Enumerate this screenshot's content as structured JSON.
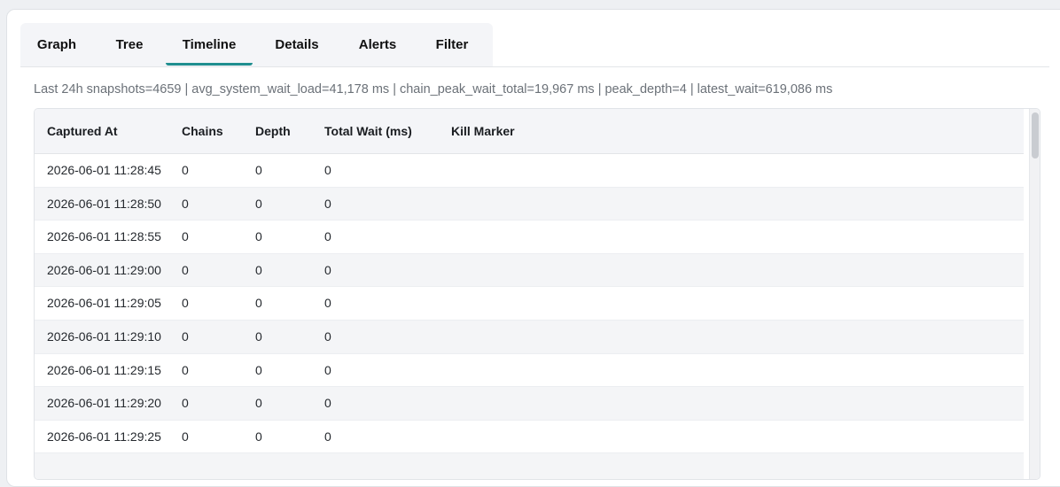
{
  "tabs": [
    {
      "label": "Graph",
      "active": false
    },
    {
      "label": "Tree",
      "active": false
    },
    {
      "label": "Timeline",
      "active": true
    },
    {
      "label": "Details",
      "active": false
    },
    {
      "label": "Alerts",
      "active": false
    },
    {
      "label": "Filter",
      "active": false
    }
  ],
  "summary": "Last 24h snapshots=4659 | avg_system_wait_load=41,178 ms | chain_peak_wait_total=19,967 ms | peak_depth=4 | latest_wait=619,086 ms",
  "table": {
    "columns": [
      "Captured At",
      "Chains",
      "Depth",
      "Total Wait (ms)",
      "Kill Marker"
    ],
    "rows": [
      [
        "2026-06-01 11:28:45",
        "0",
        "0",
        "0",
        ""
      ],
      [
        "2026-06-01 11:28:50",
        "0",
        "0",
        "0",
        ""
      ],
      [
        "2026-06-01 11:28:55",
        "0",
        "0",
        "0",
        ""
      ],
      [
        "2026-06-01 11:29:00",
        "0",
        "0",
        "0",
        ""
      ],
      [
        "2026-06-01 11:29:05",
        "0",
        "0",
        "0",
        ""
      ],
      [
        "2026-06-01 11:29:10",
        "0",
        "0",
        "0",
        ""
      ],
      [
        "2026-06-01 11:29:15",
        "0",
        "0",
        "0",
        ""
      ],
      [
        "2026-06-01 11:29:20",
        "0",
        "0",
        "0",
        ""
      ],
      [
        "2026-06-01 11:29:25",
        "0",
        "0",
        "0",
        ""
      ],
      [
        "",
        "",
        "",
        "",
        ""
      ]
    ]
  },
  "colors": {
    "accent": "#1f8e8f",
    "header_bg": "#f4f5f8",
    "alt_row_bg": "#f4f5f7",
    "summary_text": "#6b7178"
  }
}
